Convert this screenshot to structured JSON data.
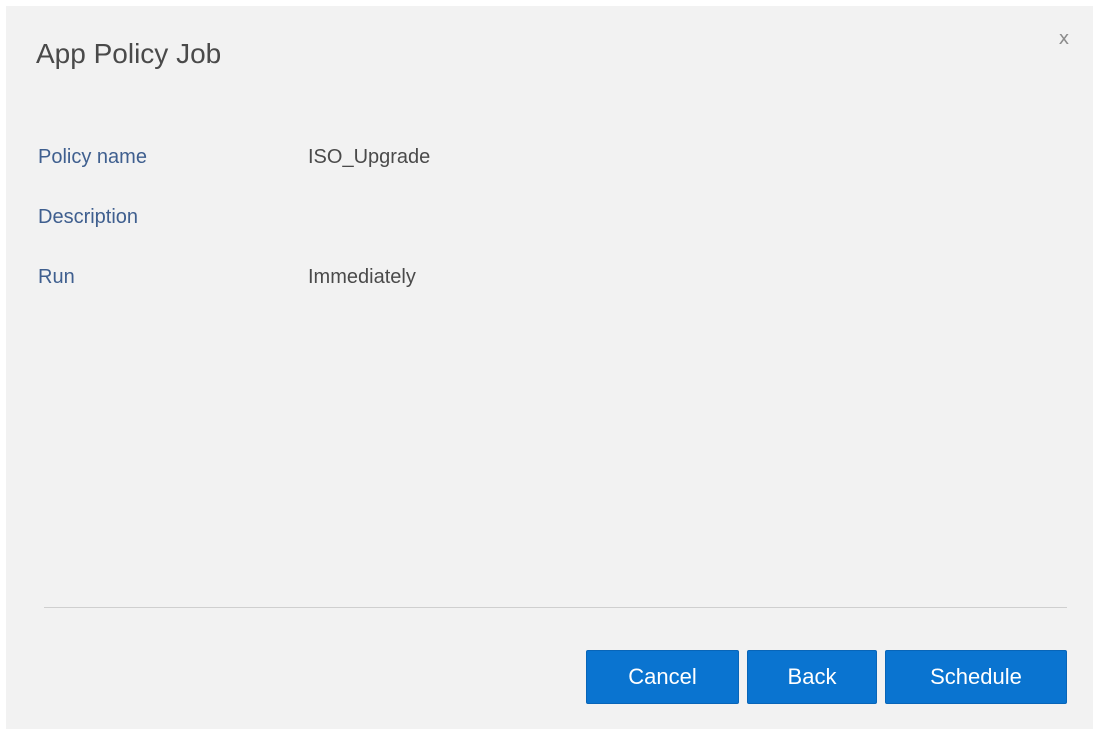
{
  "dialog": {
    "title": "App Policy Job",
    "close_label": "x"
  },
  "fields": [
    {
      "label": "Policy name",
      "value": "ISO_Upgrade"
    },
    {
      "label": "Description",
      "value": ""
    },
    {
      "label": "Run",
      "value": "Immediately"
    }
  ],
  "actions": {
    "cancel_label": "Cancel",
    "back_label": "Back",
    "schedule_label": "Schedule"
  },
  "colors": {
    "primary_button": "#0a74d0",
    "label_text": "#3f5f8f",
    "dialog_background": "#f2f2f2"
  }
}
